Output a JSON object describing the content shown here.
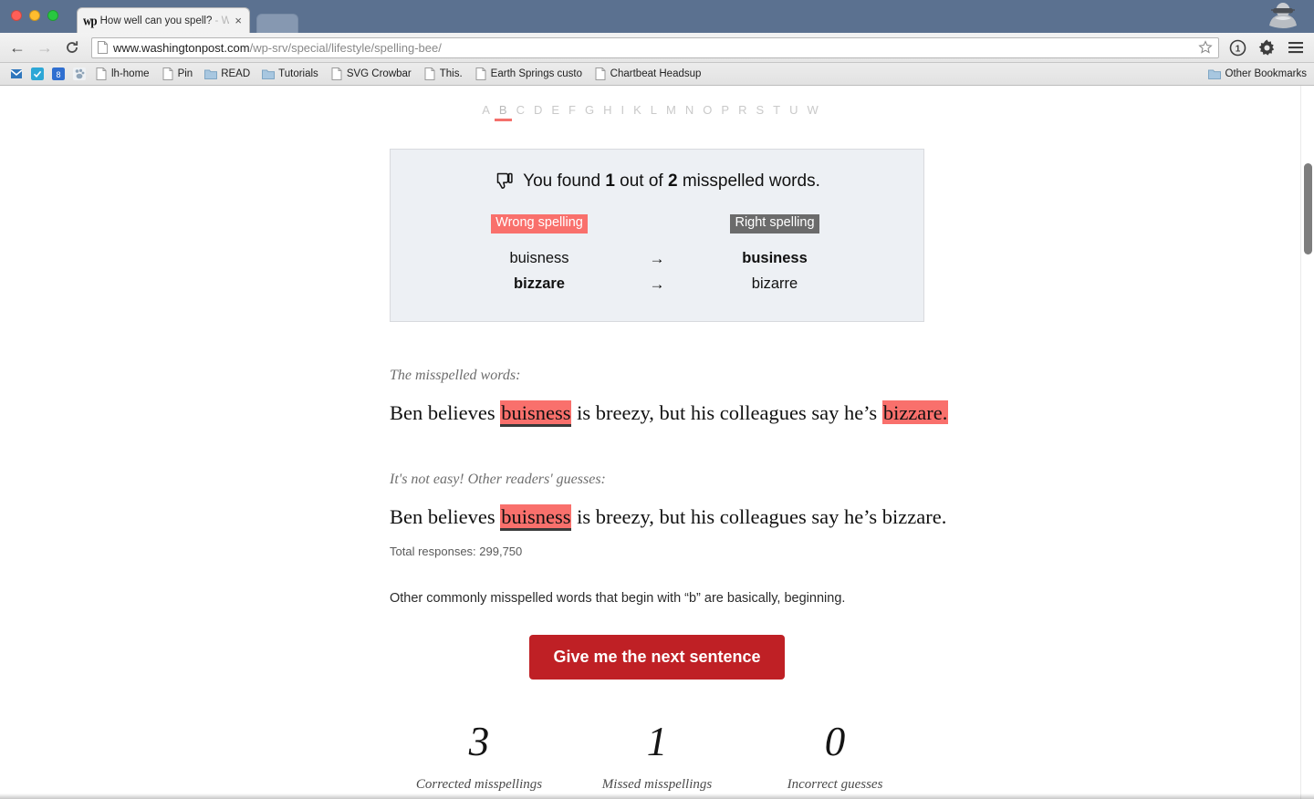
{
  "browser": {
    "tab": {
      "favicon_text": "wp",
      "title": "How well can you spell?",
      "title_dim_suffix": " - W",
      "close_label": "×"
    },
    "toolbar": {
      "back_label": "←",
      "forward_label": "→",
      "reload_label": "⟳",
      "url_host": "www.washingtonpost.com",
      "url_path": "/wp-srv/special/lifestyle/spelling-bee/",
      "star_icon": "star-icon",
      "info_icon": "info-badge-icon",
      "gear_icon": "gear-icon",
      "menu_icon": "hamburger-menu-icon",
      "incognito_icon": "incognito-spy-icon"
    },
    "bookmarks": {
      "icon_only": [
        {
          "name": "inbox-icon",
          "color": "#2e76bd"
        },
        {
          "name": "checkmark-icon",
          "color": "#2da7d6"
        },
        {
          "name": "calendar-icon",
          "color": "#2f6fd0",
          "text": "8"
        },
        {
          "name": "paw-icon",
          "color": "#9fb3c4"
        }
      ],
      "items": [
        {
          "label": "lh-home",
          "icon": "page-icon"
        },
        {
          "label": "Pin",
          "icon": "page-icon"
        },
        {
          "label": "READ",
          "icon": "folder-icon"
        },
        {
          "label": "Tutorials",
          "icon": "folder-icon"
        },
        {
          "label": "SVG Crowbar",
          "icon": "page-icon"
        },
        {
          "label": "This.",
          "icon": "page-icon"
        },
        {
          "label": "Earth Springs custom",
          "icon": "page-icon"
        },
        {
          "label": "Chartbeat Headsup",
          "icon": "page-icon"
        }
      ],
      "other_bookmarks_label": "Other Bookmarks",
      "other_bookmarks_icon": "folder-icon"
    }
  },
  "page": {
    "alphabet_nav": {
      "letters": [
        "A",
        "B",
        "C",
        "D",
        "E",
        "F",
        "G",
        "H",
        "I",
        "K",
        "L",
        "M",
        "N",
        "O",
        "P",
        "R",
        "S",
        "T",
        "U",
        "W"
      ],
      "active_letter": "B",
      "active_color": "#f4706c"
    },
    "result_panel": {
      "icon": "thumbs-down-icon",
      "headline_part1": "You found",
      "found_count": "1",
      "headline_part2": "out of",
      "total_count": "2",
      "headline_part3": "misspelled words.",
      "header_wrong": "Wrong spelling",
      "header_right": "Right spelling",
      "arrow": "→",
      "rows": [
        {
          "wrong": "buisness",
          "right": "business",
          "wrong_bold": false,
          "right_bold": true
        },
        {
          "wrong": "bizzare",
          "right": "bizarre",
          "wrong_bold": true,
          "right_bold": false
        }
      ]
    },
    "misspelled_section": {
      "label": "The misspelled words:",
      "sentence_pre": "Ben believes ",
      "word1": "buisness",
      "sentence_mid": " is breezy, but his colleagues say he’s ",
      "word2": "bizzare.",
      "word1_found": true,
      "word2_found": false
    },
    "readers_section": {
      "label": "It's not easy! Other readers' guesses:",
      "sentence_pre": "Ben believes ",
      "word1": "buisness",
      "sentence_post": " is breezy, but his colleagues say he’s bizzare.",
      "total_responses": "Total responses: 299,750"
    },
    "other_words_note": "Other commonly misspelled words that begin with “b” are basically, beginning.",
    "cta_label": "Give me the next sentence",
    "scores": [
      {
        "number": "3",
        "label": "Corrected misspellings"
      },
      {
        "number": "1",
        "label": "Missed misspellings"
      },
      {
        "number": "0",
        "label": "Incorrect guesses"
      }
    ]
  },
  "colors": {
    "wrong_highlight": "#f9706c",
    "right_chip": "#6b6b6b",
    "cta_red": "#bf2025",
    "panel_bg": "#edf0f4"
  }
}
